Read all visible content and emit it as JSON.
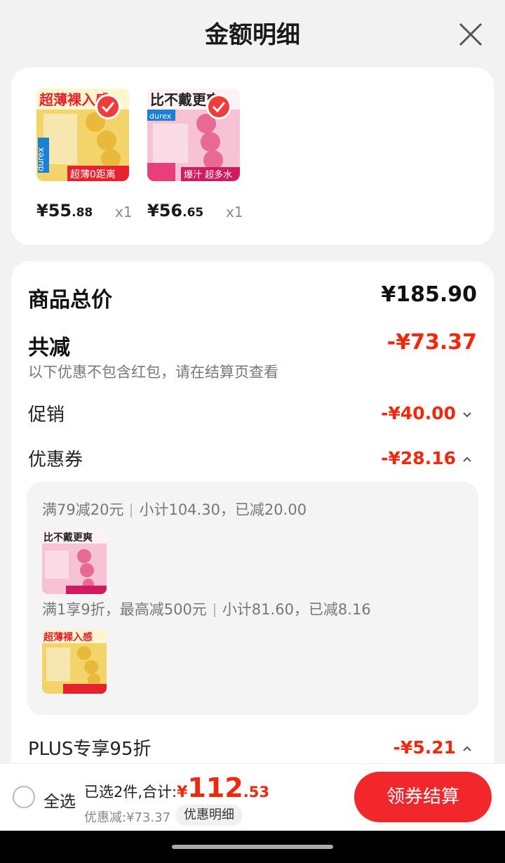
{
  "header": {
    "title": "金额明细"
  },
  "products": [
    {
      "banner": "超薄裸入感",
      "brand": "durex",
      "tag": "超薄0距离",
      "price_yen": "¥",
      "price_int": "55",
      "price_dec": ".88",
      "qty": "x1"
    },
    {
      "banner": "比不戴更爽",
      "brand": "durex",
      "tag": "爆汁 超多水",
      "price_yen": "¥",
      "price_int": "56",
      "price_dec": ".65",
      "qty": "x1"
    }
  ],
  "summary": {
    "total_label": "商品总价",
    "total_value": "¥185.90",
    "reduce_label": "共减",
    "reduce_value": "-¥73.37",
    "note": "以下优惠不包含红包，请在结算页查看",
    "promo_label": "促销",
    "promo_value": "-¥40.00",
    "coupon_label": "优惠券",
    "coupon_value": "-¥28.16",
    "plus_label": "PLUS专享95折",
    "plus_value": "-¥5.21"
  },
  "coupons": [
    {
      "rule": "满79减20元",
      "detail": "小计104.30，已减20.00"
    },
    {
      "rule": "满1享9折，最高减500元",
      "detail": "小计81.60，已减8.16"
    }
  ],
  "bottom": {
    "select_all": "全选",
    "selected_text": "已选2件,合计:",
    "total_yen": "¥",
    "total_int": "112",
    "total_dec": ".53",
    "saved": "优惠减:¥73.37",
    "detail_button": "优惠明细",
    "checkout": "领券结算"
  },
  "colors": {
    "accent": "#f2270c",
    "button": "#f2272b"
  }
}
